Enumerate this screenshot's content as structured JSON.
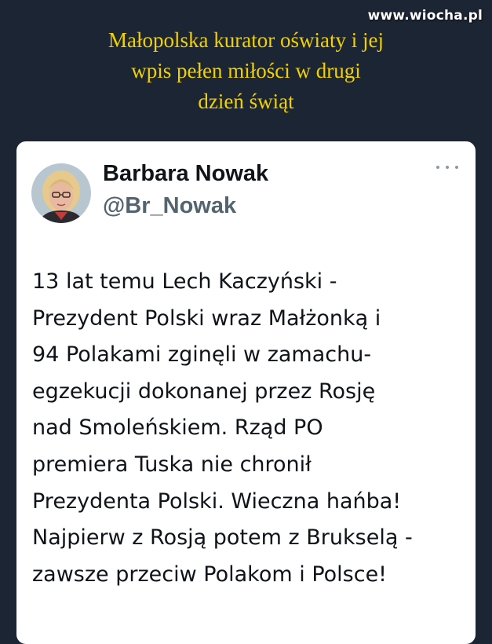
{
  "watermark": "www.wiocha.pl",
  "headline": {
    "lines": [
      "Małopolska kurator oświaty i jej",
      "wpis pełen miłości w drugi",
      "dzień świąt"
    ]
  },
  "tweet": {
    "author_name": "Barbara Nowak",
    "author_handle": "@Br_Nowak",
    "more_icon": "more-horizontal-icon",
    "lines": [
      "13 lat temu Lech Kaczyński -",
      "Prezydent Polski wraz Małżonką i",
      "94 Polakami zginęli w zamachu-",
      "egzekucji dokonanej przez Rosję",
      "nad Smoleńskiem. Rząd PO",
      "premiera Tuska nie chronił",
      "Prezydenta Polski. Wieczna hańba!",
      "Najpierw z Rosją potem z Brukselą -",
      "zawsze przeciw Polakom i Polsce!"
    ]
  },
  "colors": {
    "background": "#1c2533",
    "headline": "#f2d100",
    "card": "#ffffff",
    "text": "#0f1419",
    "handle": "#53646e"
  }
}
